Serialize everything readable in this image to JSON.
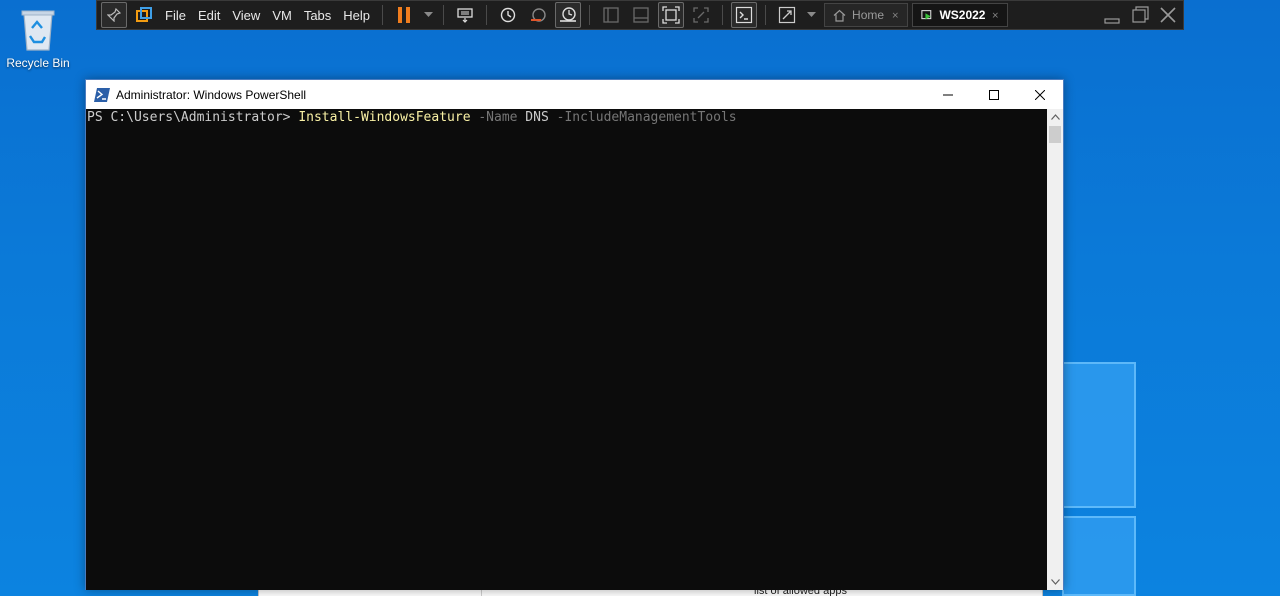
{
  "desktop": {
    "recycle_bin_label": "Recycle Bin"
  },
  "vm_toolbar": {
    "menus": [
      "File",
      "Edit",
      "View",
      "VM",
      "Tabs",
      "Help"
    ],
    "tabs": [
      {
        "label": "Home",
        "icon": "home-icon",
        "active": false
      },
      {
        "label": "WS2022",
        "icon": "vm-running-icon",
        "active": true
      }
    ],
    "pause_color": "#f07d1e"
  },
  "powershell": {
    "title": "Administrator: Windows PowerShell",
    "prompt": "PS C:\\Users\\Administrator> ",
    "command": "Install-WindowsFeature",
    "param1": " -Name",
    "arg1": " DNS",
    "param2": " -IncludeManagementTools"
  },
  "background_window": {
    "text": "list of allowed apps"
  }
}
